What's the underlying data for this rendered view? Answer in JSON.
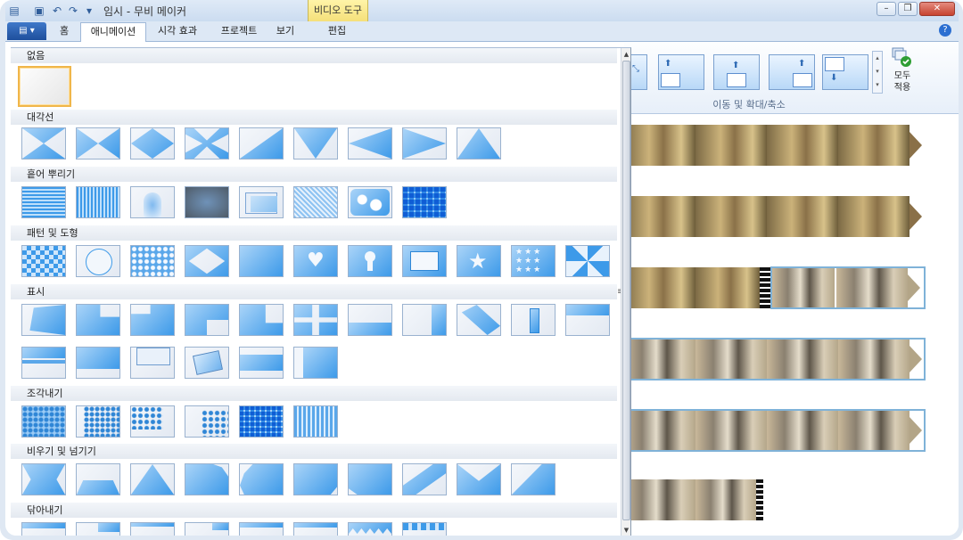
{
  "titlebar": {
    "title": "임시 - 무비 메이커",
    "context_tab": "비디오 도구",
    "quick_access": [
      "save-icon",
      "undo-icon",
      "redo-icon",
      "customize-icon"
    ],
    "window_controls": [
      "minimize",
      "restore",
      "close"
    ]
  },
  "ribbon": {
    "tabs": [
      "홈",
      "애니메이션",
      "시각 효과",
      "프로젝트",
      "보기",
      "편집"
    ],
    "active_tab": "애니메이션",
    "pan_zoom_group_label": "이동 및 확대/축소",
    "apply_all_label": "모두\n적용"
  },
  "transitions_panel": {
    "categories": [
      {
        "name": "없음",
        "count": 1
      },
      {
        "name": "대각선",
        "count": 9
      },
      {
        "name": "흩어 뿌리기",
        "count": 8
      },
      {
        "name": "패턴 및 도형",
        "count": 11
      },
      {
        "name": "표시",
        "count": 17
      },
      {
        "name": "조각내기",
        "count": 6
      },
      {
        "name": "비우기 및 넘기기",
        "count": 10
      },
      {
        "name": "닦아내기",
        "count": 8
      }
    ]
  },
  "storyboard": {
    "clips": [
      "forest-clip",
      "forest-clip",
      "forest-and-cat-clip",
      "cat-clip",
      "cat-clip",
      "cat-clip"
    ]
  },
  "colors": {
    "accent": "#3d9ae9",
    "selection": "#f0b64a",
    "ribbon_bg": "#dde8f5"
  }
}
